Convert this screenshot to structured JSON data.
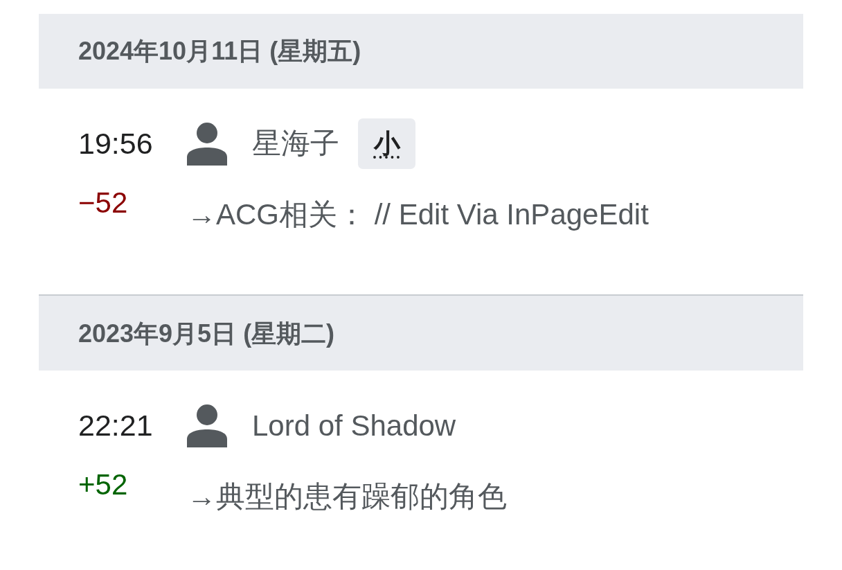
{
  "days": [
    {
      "date": "2024年10月11日 (星期五)",
      "edits": [
        {
          "time": "19:56",
          "user": "星海子",
          "tags": [
            "小"
          ],
          "size_change": "−52",
          "color": "#8b0000",
          "summary": "→ACG相关： // Edit Via InPageEdit"
        }
      ]
    },
    {
      "date": "2023年9月5日 (星期二)",
      "edits": [
        {
          "time": "22:21",
          "user": "Lord of Shadow",
          "size_change": "+52",
          "color": "#006400",
          "summary": "→典型的患有躁郁的角色"
        }
      ]
    }
  ]
}
